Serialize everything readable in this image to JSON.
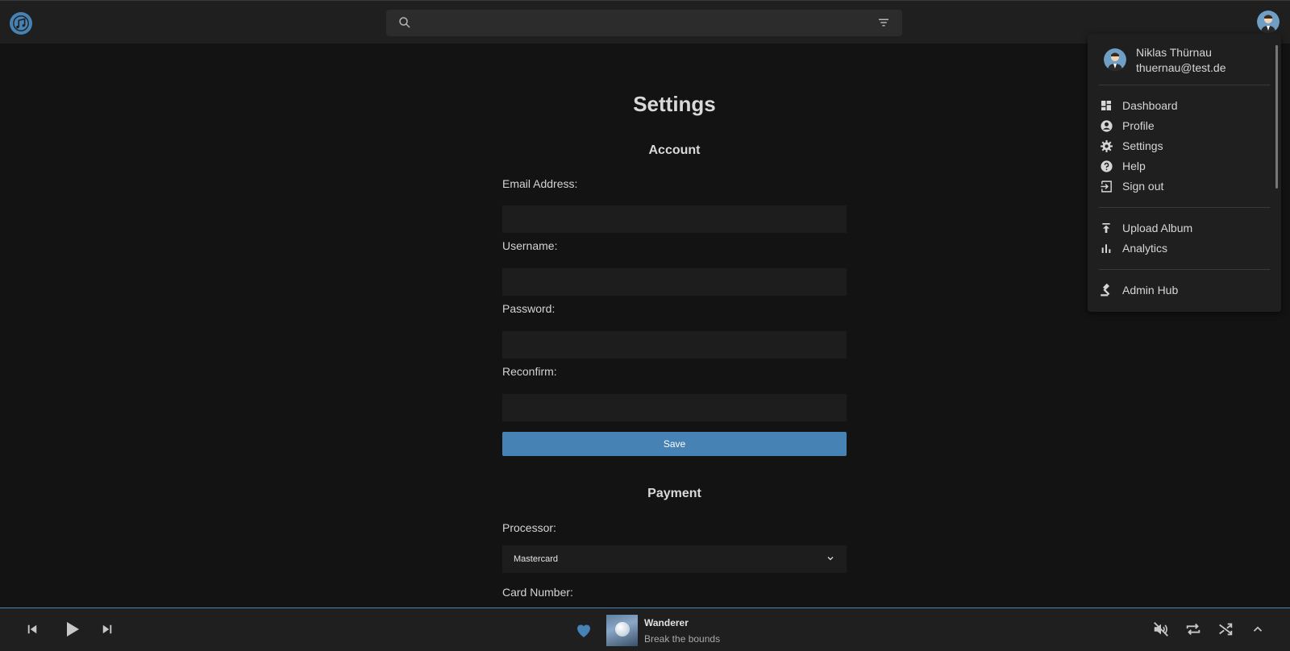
{
  "header": {
    "search_placeholder": "",
    "search_value": ""
  },
  "settings": {
    "title": "Settings",
    "account": {
      "section_title": "Account",
      "email_label": "Email Address:",
      "username_label": "Username:",
      "password_label": "Password:",
      "reconfirm_label": "Reconfirm:",
      "email_value": "",
      "username_value": "",
      "password_value": "",
      "reconfirm_value": "",
      "save_label": "Save"
    },
    "payment": {
      "section_title": "Payment",
      "processor_label": "Processor:",
      "processor_selected": "Mastercard",
      "card_number_label": "Card Number:"
    }
  },
  "user_menu": {
    "name": "Niklas Thürnau",
    "email": "thuernau@test.de",
    "items": [
      {
        "label": "Dashboard",
        "icon": "dashboard-icon"
      },
      {
        "label": "Profile",
        "icon": "account-circle-icon"
      },
      {
        "label": "Settings",
        "icon": "gear-icon"
      },
      {
        "label": "Help",
        "icon": "help-icon"
      },
      {
        "label": "Sign out",
        "icon": "sign-out-icon"
      }
    ],
    "items2": [
      {
        "label": "Upload Album",
        "icon": "upload-icon"
      },
      {
        "label": "Analytics",
        "icon": "bar-chart-icon"
      }
    ],
    "items3": [
      {
        "label": "Admin Hub",
        "icon": "gavel-icon"
      }
    ]
  },
  "player": {
    "track_title": "Wanderer",
    "track_artist": "Break the bounds",
    "liked": true,
    "muted": true
  },
  "colors": {
    "accent": "#4682b4",
    "background": "#131313",
    "surface": "#1f1f1f",
    "input": "#1d1d1d"
  }
}
